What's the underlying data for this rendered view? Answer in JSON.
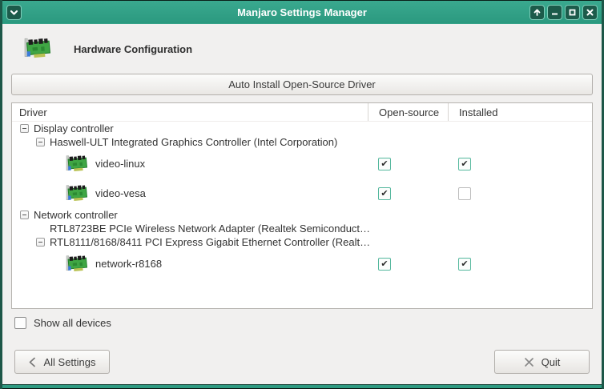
{
  "window": {
    "title": "Manjaro Settings Manager"
  },
  "header": {
    "title": "Hardware Configuration"
  },
  "actions": {
    "auto_install": "Auto Install Open-Source Driver"
  },
  "table": {
    "columns": {
      "driver": "Driver",
      "open_source": "Open-source",
      "installed": "Installed"
    },
    "items": [
      {
        "label": "Display controller",
        "level": 0,
        "expandable": true
      },
      {
        "label": "Haswell-ULT Integrated Graphics Controller (Intel Corporation)",
        "level": 1,
        "expandable": true
      },
      {
        "label": "video-linux",
        "level": 2,
        "open_source": true,
        "installed": true
      },
      {
        "label": "video-vesa",
        "level": 2,
        "open_source": true,
        "installed": false
      },
      {
        "label": "Network controller",
        "level": 0,
        "expandable": true
      },
      {
        "label": "RTL8723BE PCIe Wireless Network Adapter (Realtek Semiconduct…",
        "level": 1,
        "expandable": false
      },
      {
        "label": "RTL8111/8168/8411 PCI Express Gigabit Ethernet Controller (Realt…",
        "level": 1,
        "expandable": true
      },
      {
        "label": "network-r8168",
        "level": 2,
        "open_source": true,
        "installed": true
      }
    ]
  },
  "footer": {
    "show_all_devices": "Show all devices",
    "show_all_checked": false,
    "all_settings": "All Settings",
    "quit": "Quit"
  },
  "colors": {
    "titlebar": "#2f9f86",
    "titlebar_button": "#1c5b4b",
    "checkbox_accent": "#55b89e",
    "window_border": "#1d5748"
  }
}
